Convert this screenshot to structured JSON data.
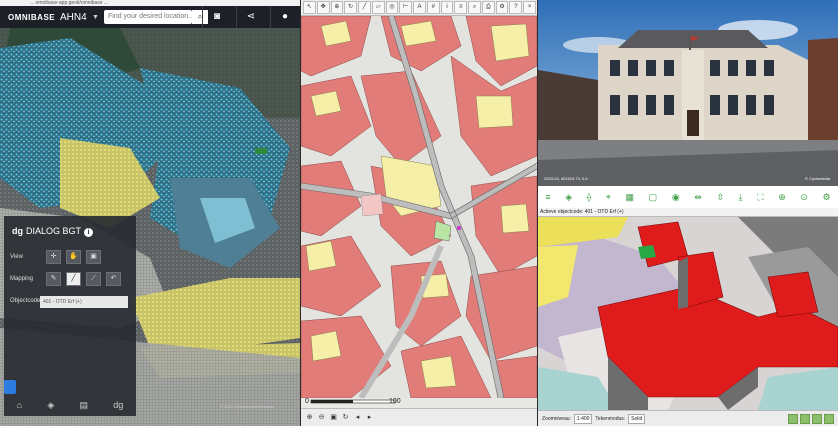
{
  "pane_3d": {
    "url_text": "... omnibase-app.geoit/omnibase ...",
    "logo": "OMNIBASE",
    "layer_name": "AHN4",
    "search_placeholder": "Find your desired location...",
    "dialog": {
      "title_prefix": "dg",
      "title": "DIALOG BGT",
      "view_label": "View",
      "mapping_label": "Mapping",
      "objectcode_label": "Objectcode",
      "objectcode_value": "401 - OTD Erf (+)"
    },
    "copyright": "© 2023 Cyclomedia/Omnibase"
  },
  "pane_map": {
    "scale_start": "0",
    "scale_end": "100"
  },
  "pane_street": {
    "caption_left": "2023-03, 401515.73, 0.6",
    "caption_right": "© Cyclomedia"
  },
  "pane_model": {
    "title": "Actieve objectcode: 401 - OTD Erf (+)",
    "scale_label": "Zoomniveau:",
    "scale_value": "1:400",
    "mode_label": "Tekenmodus:",
    "mode_value": "Solid"
  }
}
